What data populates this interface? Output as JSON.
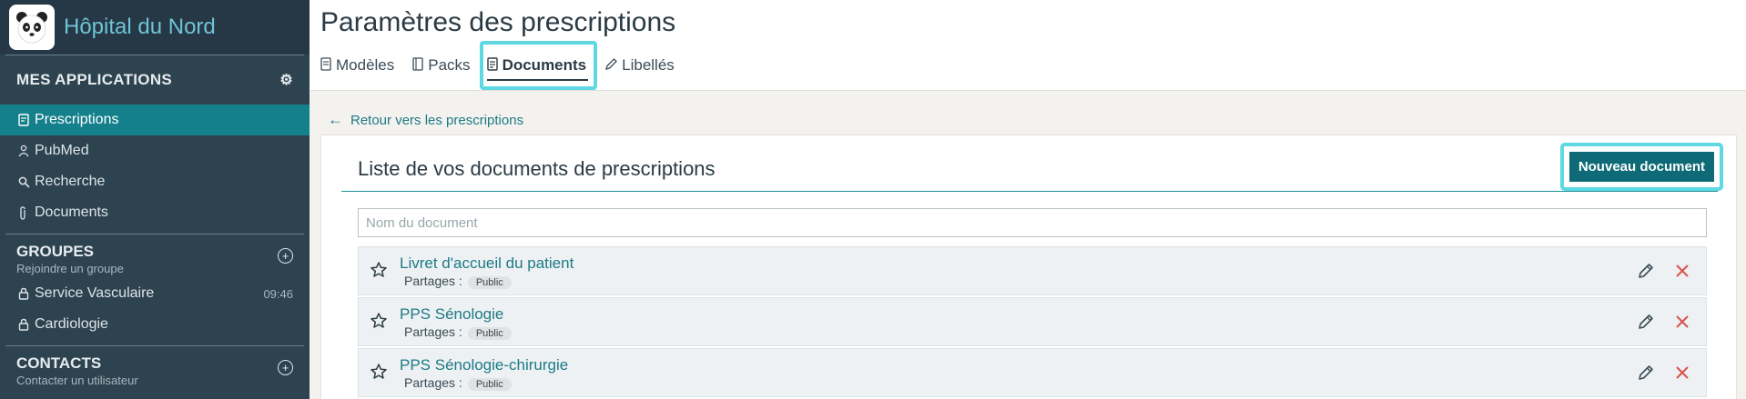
{
  "brand": {
    "name": "Hôpital du Nord"
  },
  "sidebar": {
    "apps_title": "MES APPLICATIONS",
    "apps": [
      {
        "label": "Prescriptions",
        "icon": "prescription-icon",
        "active": true
      },
      {
        "label": "PubMed",
        "icon": "pubmed-icon"
      },
      {
        "label": "Recherche",
        "icon": "search-icon"
      },
      {
        "label": "Documents",
        "icon": "paperclip-icon"
      }
    ],
    "groups_title": "GROUPES",
    "groups_sub": "Rejoindre un groupe",
    "groups": [
      {
        "label": "Service Vasculaire",
        "time": "09:46"
      },
      {
        "label": "Cardiologie",
        "time": ""
      }
    ],
    "contacts_title": "CONTACTS",
    "contacts_sub": "Contacter un utilisateur"
  },
  "header": {
    "title": "Paramètres des prescriptions",
    "tabs": [
      {
        "label": "Modèles"
      },
      {
        "label": "Packs"
      },
      {
        "label": "Documents",
        "active": true
      },
      {
        "label": "Libellés"
      }
    ]
  },
  "main": {
    "back_label": "Retour vers les prescriptions",
    "list_title": "Liste de vos documents de prescriptions",
    "new_button": "Nouveau document",
    "search_placeholder": "Nom du document",
    "share_label": "Partages :",
    "documents": [
      {
        "name": "Livret d'accueil du patient",
        "badge": "Public"
      },
      {
        "name": "PPS Sénologie",
        "badge": "Public"
      },
      {
        "name": "PPS Sénologie-chirurgie",
        "badge": "Public"
      }
    ]
  },
  "colors": {
    "accent": "#14808c",
    "highlight": "#5ed8e3",
    "sidebar": "#2e4350",
    "delete": "#d9534f"
  }
}
